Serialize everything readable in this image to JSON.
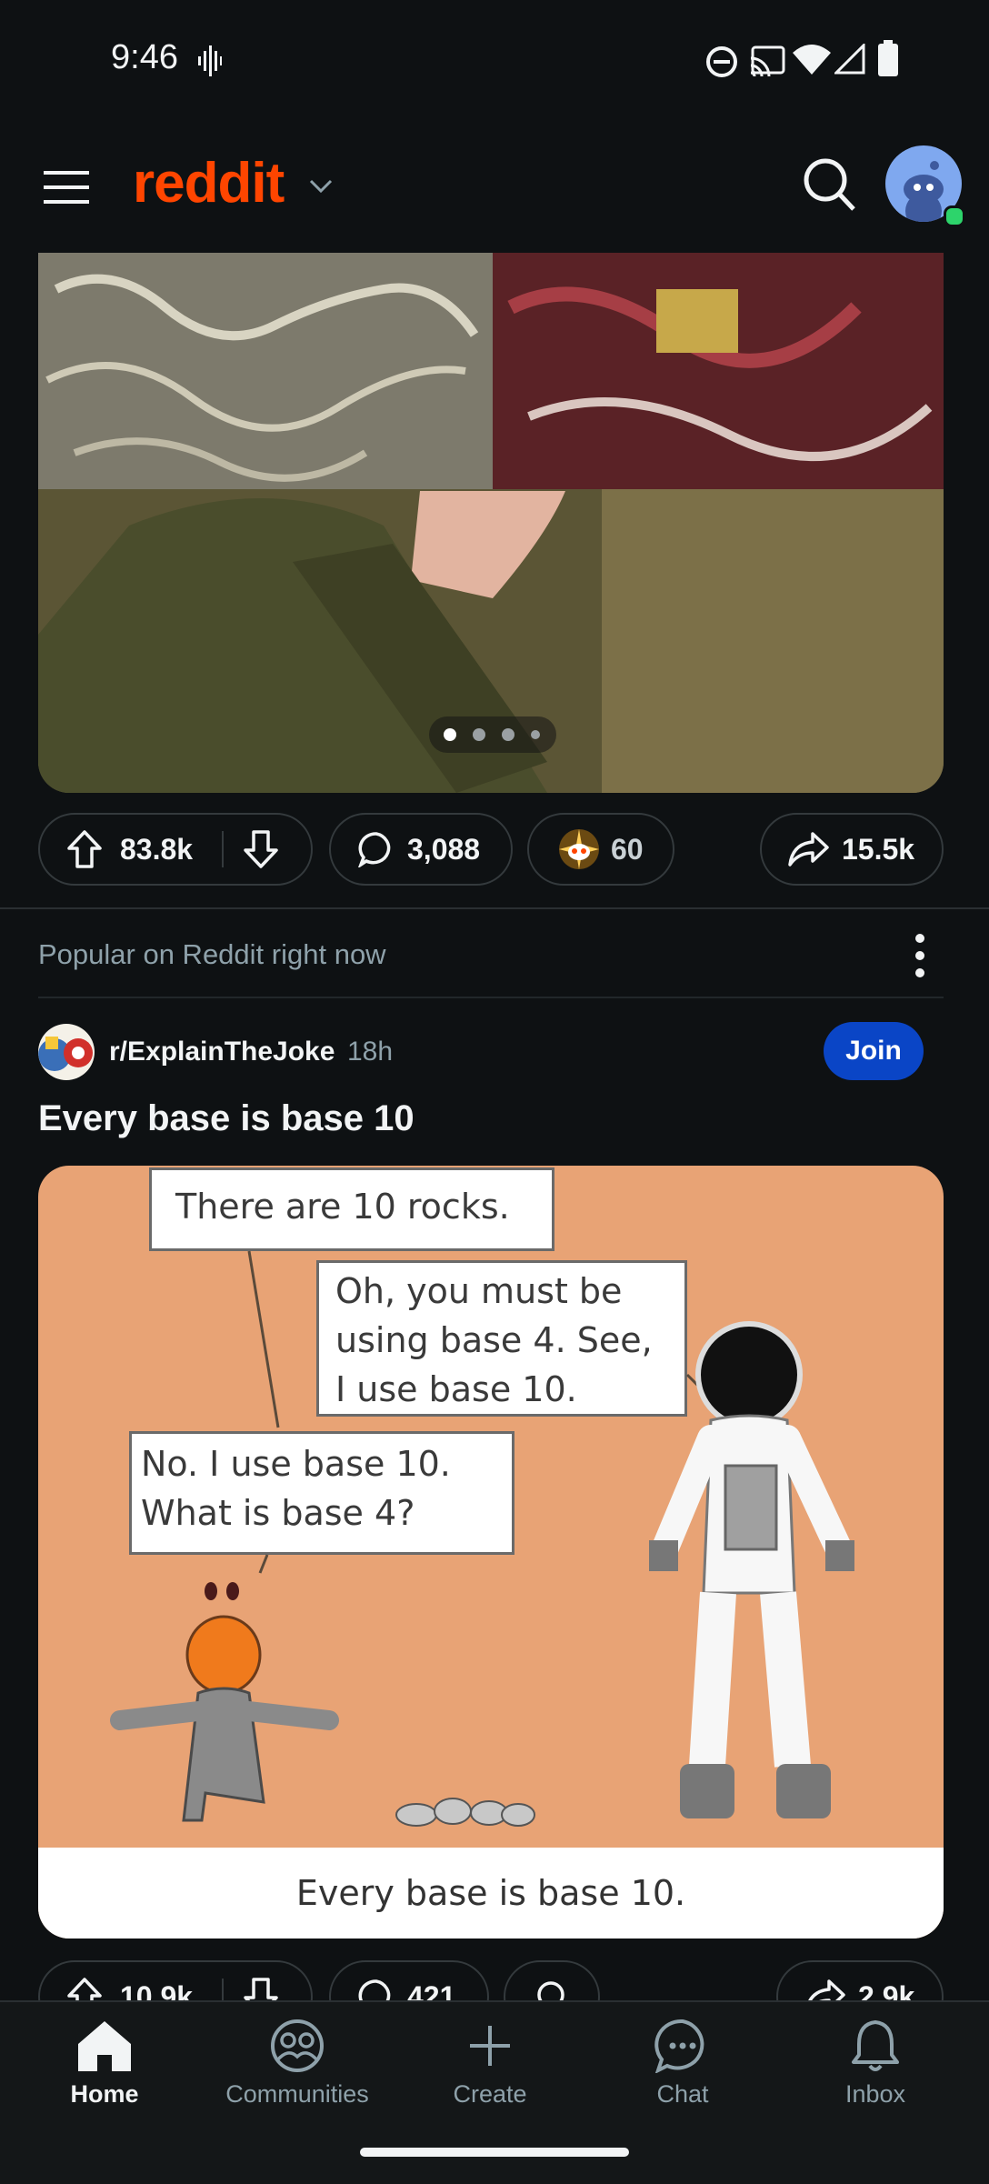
{
  "status_bar": {
    "time": "9:46"
  },
  "header": {
    "logo": "reddit"
  },
  "post1": {
    "upvotes": "83.8k",
    "comments": "3,088",
    "awards": "60",
    "shares": "15.5k",
    "carousel": {
      "pages": 4,
      "active_index": 0
    }
  },
  "section": {
    "label": "Popular on Reddit right now"
  },
  "post2": {
    "subreddit": "r/ExplainTheJoke",
    "age": "18h",
    "join_label": "Join",
    "title": "Every base is base 10",
    "comic": {
      "bubble1": "There are 10 rocks.",
      "bubble2_line1": "Oh, you must be",
      "bubble2_line2": "using base 4.  See,",
      "bubble2_line3": "I use base 10.",
      "bubble3_line1": "No.  I use base 10.",
      "bubble3_line2": "What is base 4?",
      "caption": "Every base is base 10."
    },
    "upvotes": "10.9k",
    "comments": "421",
    "shares": "2.9k"
  },
  "nav": {
    "home": "Home",
    "communities": "Communities",
    "create": "Create",
    "chat": "Chat",
    "inbox": "Inbox"
  }
}
